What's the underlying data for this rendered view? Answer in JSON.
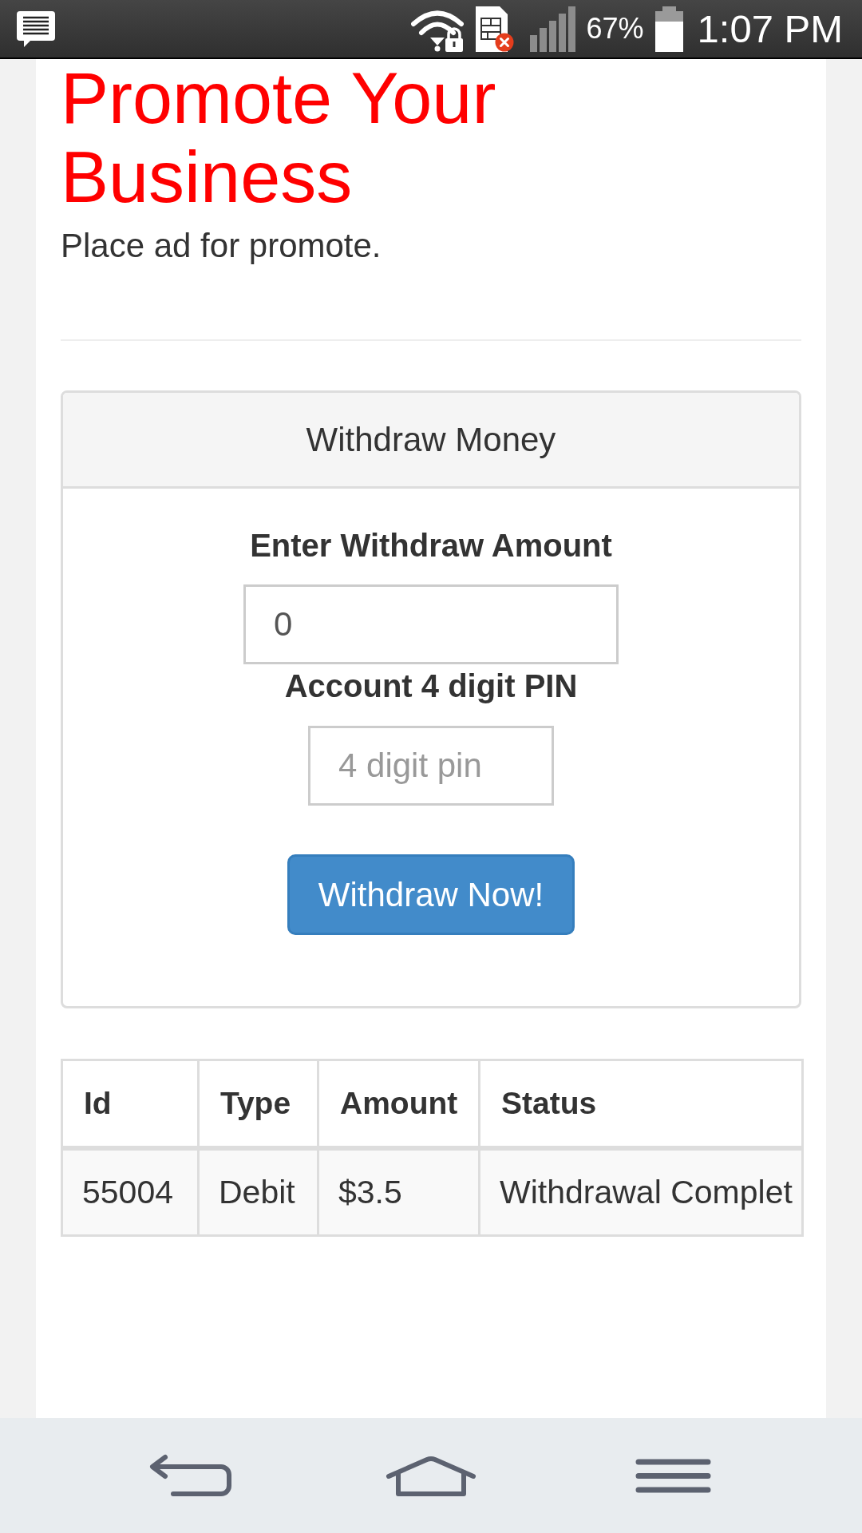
{
  "status_bar": {
    "battery_percent": "67%",
    "time": "1:07 PM"
  },
  "header": {
    "title": "Promote Your Business",
    "subtitle": "Place ad for promote."
  },
  "withdraw_panel": {
    "title": "Withdraw Money",
    "amount_label": "Enter Withdraw Amount",
    "amount_field": {
      "value": "0"
    },
    "pin_label": "Account 4 digit PIN",
    "pin_field": {
      "placeholder": "4 digit pin"
    },
    "submit_button": "Withdraw Now!"
  },
  "transactions_table": {
    "columns": [
      "Id",
      "Type",
      "Amount",
      "Status"
    ],
    "rows": [
      [
        "55004",
        "Debit",
        "$3.5",
        "Withdrawal Complet"
      ]
    ]
  }
}
